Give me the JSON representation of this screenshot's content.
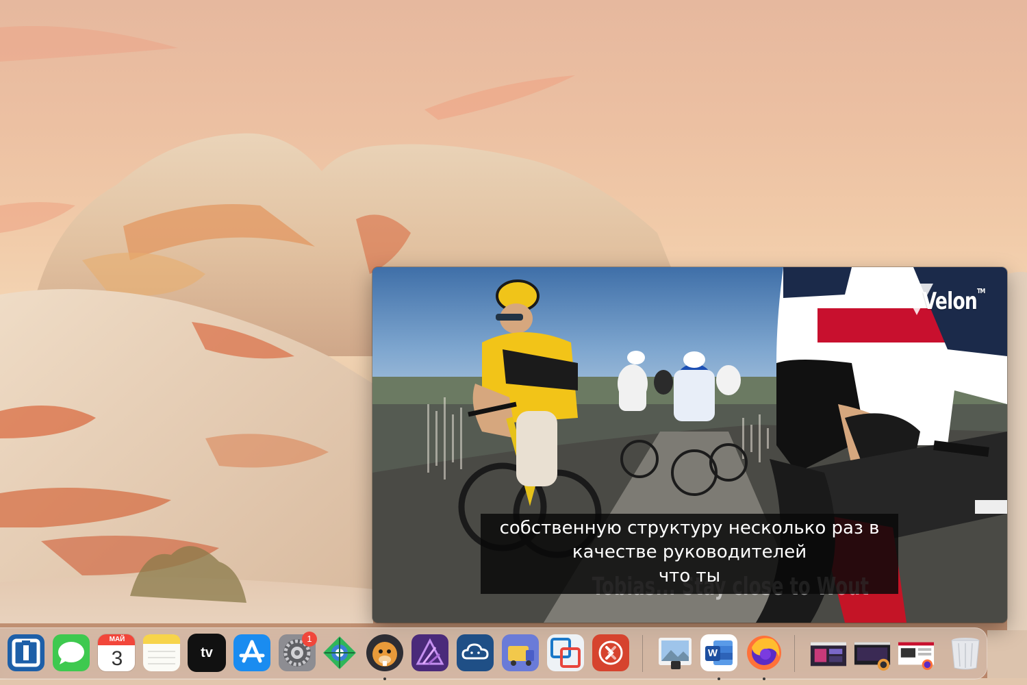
{
  "video": {
    "logo_text": "Velon",
    "logo_tm": "TM",
    "burned_in_caption": "Tobias... Stay close to Wout",
    "subtitle_lines": [
      "собственную структуру несколько раз в",
      "качестве руководителей",
      "что ты"
    ]
  },
  "dock": {
    "calendar_month": "МАЙ",
    "calendar_day": "3",
    "tv_label": "tv",
    "settings_badge": "1",
    "word_letter": "W",
    "apps": [
      {
        "name": "screen-sharing",
        "icon": "screen-sharing-icon",
        "running": false
      },
      {
        "name": "messages",
        "icon": "messages-icon",
        "running": false
      },
      {
        "name": "calendar",
        "icon": "calendar-icon",
        "running": false
      },
      {
        "name": "notes",
        "icon": "notes-icon",
        "running": false
      },
      {
        "name": "apple-tv",
        "icon": "apple-tv-icon",
        "running": false
      },
      {
        "name": "app-store",
        "icon": "app-store-icon",
        "running": false
      },
      {
        "name": "system-preferences",
        "icon": "system-preferences-icon",
        "running": false
      },
      {
        "name": "network-app",
        "icon": "network-app-icon",
        "running": false
      },
      {
        "name": "beaver-app",
        "icon": "beaver-app-icon",
        "running": true
      },
      {
        "name": "affinity-photo",
        "icon": "affinity-photo-icon",
        "running": false
      },
      {
        "name": "cloud-app",
        "icon": "cloud-app-icon",
        "running": false
      },
      {
        "name": "transmit",
        "icon": "transmit-icon",
        "running": false
      },
      {
        "name": "vmware-fusion",
        "icon": "vmware-fusion-icon",
        "running": false
      },
      {
        "name": "remote-desktop",
        "icon": "remote-desktop-icon",
        "running": false
      },
      {
        "name": "preview",
        "icon": "preview-icon",
        "running": false
      },
      {
        "name": "microsoft-word",
        "icon": "microsoft-word-icon",
        "running": true
      },
      {
        "name": "firefox",
        "icon": "firefox-icon",
        "running": true
      },
      {
        "name": "minimized-window-1",
        "icon": "window-thumbnail-icon",
        "running": false
      },
      {
        "name": "minimized-window-2",
        "icon": "window-thumbnail-icon",
        "running": false
      },
      {
        "name": "minimized-window-3",
        "icon": "window-thumbnail-icon",
        "running": false
      },
      {
        "name": "trash",
        "icon": "trash-icon",
        "running": false
      }
    ]
  },
  "colors": {
    "sky_top": "#e6b89e",
    "rock_cream": "#eadccb",
    "rock_orange": "#d9663c",
    "subtitle_bg": "#080808",
    "badge_red": "#f0473b"
  }
}
